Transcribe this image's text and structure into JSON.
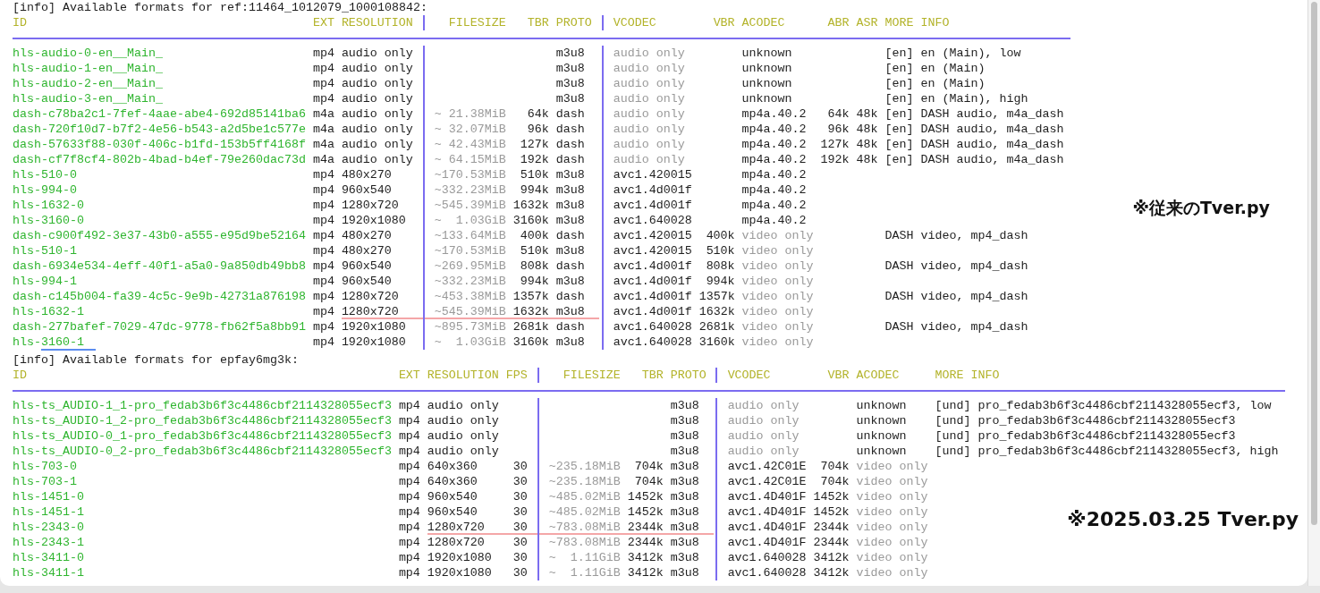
{
  "tables": [
    {
      "info": "[info] Available formats for ref:11464_1012079_1000108842:",
      "columns": [
        "ID",
        "EXT",
        "RESOLUTION",
        "FILESIZE",
        "TBR",
        "PROTO",
        "VCODEC",
        "VBR",
        "ACODEC",
        "ABR",
        "ASR",
        "MORE INFO"
      ],
      "rows": [
        {
          "kind": "audio",
          "highlighted": false,
          "id_underlined": false,
          "id": "hls-audio-0-en__Main_",
          "ext": "mp4",
          "resolution": "audio only",
          "proto": "m3u8",
          "vcodec": "audio only",
          "acodec": "unknown",
          "more_info": "[en] en (Main), low"
        },
        {
          "kind": "audio",
          "highlighted": false,
          "id_underlined": false,
          "id": "hls-audio-1-en__Main_",
          "ext": "mp4",
          "resolution": "audio only",
          "proto": "m3u8",
          "vcodec": "audio only",
          "acodec": "unknown",
          "more_info": "[en] en (Main)"
        },
        {
          "kind": "audio",
          "highlighted": false,
          "id_underlined": false,
          "id": "hls-audio-2-en__Main_",
          "ext": "mp4",
          "resolution": "audio only",
          "proto": "m3u8",
          "vcodec": "audio only",
          "acodec": "unknown",
          "more_info": "[en] en (Main)"
        },
        {
          "kind": "audio",
          "highlighted": false,
          "id_underlined": false,
          "id": "hls-audio-3-en__Main_",
          "ext": "mp4",
          "resolution": "audio only",
          "proto": "m3u8",
          "vcodec": "audio only",
          "acodec": "unknown",
          "more_info": "[en] en (Main), high"
        },
        {
          "kind": "audio",
          "highlighted": false,
          "id_underlined": false,
          "id": "dash-c78ba2c1-7fef-4aae-abe4-692d85141ba6",
          "ext": "m4a",
          "resolution": "audio only",
          "filesize": "~ 21.38MiB",
          "tbr": "64k",
          "proto": "dash",
          "vcodec": "audio only",
          "acodec": "mp4a.40.2",
          "abr": "64k",
          "asr": "48k",
          "more_info": "[en] DASH audio, m4a_dash"
        },
        {
          "kind": "audio",
          "highlighted": false,
          "id_underlined": false,
          "id": "dash-720f10d7-b7f2-4e56-b543-a2d5be1c577e",
          "ext": "m4a",
          "resolution": "audio only",
          "filesize": "~ 32.07MiB",
          "tbr": "96k",
          "proto": "dash",
          "vcodec": "audio only",
          "acodec": "mp4a.40.2",
          "abr": "96k",
          "asr": "48k",
          "more_info": "[en] DASH audio, m4a_dash"
        },
        {
          "kind": "audio",
          "highlighted": false,
          "id_underlined": false,
          "id": "dash-57633f88-030f-406c-b1fd-153b5ff4168f",
          "ext": "m4a",
          "resolution": "audio only",
          "filesize": "~ 42.43MiB",
          "tbr": "127k",
          "proto": "dash",
          "vcodec": "audio only",
          "acodec": "mp4a.40.2",
          "abr": "127k",
          "asr": "48k",
          "more_info": "[en] DASH audio, m4a_dash"
        },
        {
          "kind": "audio",
          "highlighted": false,
          "id_underlined": false,
          "id": "dash-cf7f8cf4-802b-4bad-b4ef-79e260dac73d",
          "ext": "m4a",
          "resolution": "audio only",
          "filesize": "~ 64.15MiB",
          "tbr": "192k",
          "proto": "dash",
          "vcodec": "audio only",
          "acodec": "mp4a.40.2",
          "abr": "192k",
          "asr": "48k",
          "more_info": "[en] DASH audio, m4a_dash"
        },
        {
          "kind": "muxed",
          "highlighted": false,
          "id_underlined": false,
          "id": "hls-510-0",
          "ext": "mp4",
          "resolution": "480x270",
          "filesize": "~170.53MiB",
          "tbr": "510k",
          "proto": "m3u8",
          "vcodec": "avc1.420015",
          "acodec": "mp4a.40.2"
        },
        {
          "kind": "muxed",
          "highlighted": false,
          "id_underlined": false,
          "id": "hls-994-0",
          "ext": "mp4",
          "resolution": "960x540",
          "filesize": "~332.23MiB",
          "tbr": "994k",
          "proto": "m3u8",
          "vcodec": "avc1.4d001f",
          "acodec": "mp4a.40.2"
        },
        {
          "kind": "muxed",
          "highlighted": false,
          "id_underlined": false,
          "id": "hls-1632-0",
          "ext": "mp4",
          "resolution": "1280x720",
          "filesize": "~545.39MiB",
          "tbr": "1632k",
          "proto": "m3u8",
          "vcodec": "avc1.4d001f",
          "acodec": "mp4a.40.2"
        },
        {
          "kind": "muxed",
          "highlighted": false,
          "id_underlined": false,
          "id": "hls-3160-0",
          "ext": "mp4",
          "resolution": "1920x1080",
          "filesize": "~  1.03GiB",
          "tbr": "3160k",
          "proto": "m3u8",
          "vcodec": "avc1.640028",
          "acodec": "mp4a.40.2"
        },
        {
          "kind": "video",
          "highlighted": false,
          "id_underlined": false,
          "id": "dash-c900f492-3e37-43b0-a555-e95d9be52164",
          "ext": "mp4",
          "resolution": "480x270",
          "filesize": "~133.64MiB",
          "tbr": "400k",
          "proto": "dash",
          "vcodec": "avc1.420015",
          "vbr": "400k",
          "acodec": "video only",
          "more_info": "DASH video, mp4_dash"
        },
        {
          "kind": "video",
          "highlighted": false,
          "id_underlined": false,
          "id": "hls-510-1",
          "ext": "mp4",
          "resolution": "480x270",
          "filesize": "~170.53MiB",
          "tbr": "510k",
          "proto": "m3u8",
          "vcodec": "avc1.420015",
          "vbr": "510k",
          "acodec": "video only"
        },
        {
          "kind": "video",
          "highlighted": false,
          "id_underlined": false,
          "id": "dash-6934e534-4eff-40f1-a5a0-9a850db49bb8",
          "ext": "mp4",
          "resolution": "960x540",
          "filesize": "~269.95MiB",
          "tbr": "808k",
          "proto": "dash",
          "vcodec": "avc1.4d001f",
          "vbr": "808k",
          "acodec": "video only",
          "more_info": "DASH video, mp4_dash"
        },
        {
          "kind": "video",
          "highlighted": false,
          "id_underlined": false,
          "id": "hls-994-1",
          "ext": "mp4",
          "resolution": "960x540",
          "filesize": "~332.23MiB",
          "tbr": "994k",
          "proto": "m3u8",
          "vcodec": "avc1.4d001f",
          "vbr": "994k",
          "acodec": "video only"
        },
        {
          "kind": "video",
          "highlighted": false,
          "id_underlined": false,
          "id": "dash-c145b004-fa39-4c5c-9e9b-42731a876198",
          "ext": "mp4",
          "resolution": "1280x720",
          "filesize": "~453.38MiB",
          "tbr": "1357k",
          "proto": "dash",
          "vcodec": "avc1.4d001f",
          "vbr": "1357k",
          "acodec": "video only",
          "more_info": "DASH video, mp4_dash"
        },
        {
          "kind": "video",
          "highlighted": true,
          "id_underlined": false,
          "id": "hls-1632-1",
          "ext": "mp4",
          "resolution": "1280x720",
          "filesize": "~545.39MiB",
          "tbr": "1632k",
          "proto": "m3u8",
          "vcodec": "avc1.4d001f",
          "vbr": "1632k",
          "acodec": "video only"
        },
        {
          "kind": "video",
          "highlighted": false,
          "id_underlined": false,
          "id": "dash-277bafef-7029-47dc-9778-fb62f5a8bb91",
          "ext": "mp4",
          "resolution": "1920x1080",
          "filesize": "~895.73MiB",
          "tbr": "2681k",
          "proto": "dash",
          "vcodec": "avc1.640028",
          "vbr": "2681k",
          "acodec": "video only",
          "more_info": "DASH video, mp4_dash"
        },
        {
          "kind": "video",
          "highlighted": false,
          "id_underlined": true,
          "id": "hls-3160-1",
          "ext": "mp4",
          "resolution": "1920x1080",
          "filesize": "~  1.03GiB",
          "tbr": "3160k",
          "proto": "m3u8",
          "vcodec": "avc1.640028",
          "vbr": "3160k",
          "acodec": "video only"
        }
      ]
    },
    {
      "info": "[info] Available formats for epfay6mg3k:",
      "columns": [
        "ID",
        "EXT",
        "RESOLUTION",
        "FPS",
        "FILESIZE",
        "TBR",
        "PROTO",
        "VCODEC",
        "VBR",
        "ACODEC",
        "MORE INFO"
      ],
      "rows": [
        {
          "kind": "audio",
          "highlighted": false,
          "id_underlined": false,
          "id": "hls-ts_AUDIO-1_1-pro_fedab3b6f3c4486cbf2114328055ecf3",
          "ext": "mp4",
          "resolution": "audio only",
          "proto": "m3u8",
          "vcodec": "audio only",
          "acodec": "unknown",
          "more_info": "[und] pro_fedab3b6f3c4486cbf2114328055ecf3, low"
        },
        {
          "kind": "audio",
          "highlighted": false,
          "id_underlined": false,
          "id": "hls-ts_AUDIO-1_2-pro_fedab3b6f3c4486cbf2114328055ecf3",
          "ext": "mp4",
          "resolution": "audio only",
          "proto": "m3u8",
          "vcodec": "audio only",
          "acodec": "unknown",
          "more_info": "[und] pro_fedab3b6f3c4486cbf2114328055ecf3"
        },
        {
          "kind": "audio",
          "highlighted": false,
          "id_underlined": false,
          "id": "hls-ts_AUDIO-0_1-pro_fedab3b6f3c4486cbf2114328055ecf3",
          "ext": "mp4",
          "resolution": "audio only",
          "proto": "m3u8",
          "vcodec": "audio only",
          "acodec": "unknown",
          "more_info": "[und] pro_fedab3b6f3c4486cbf2114328055ecf3"
        },
        {
          "kind": "audio",
          "highlighted": false,
          "id_underlined": false,
          "id": "hls-ts_AUDIO-0_2-pro_fedab3b6f3c4486cbf2114328055ecf3",
          "ext": "mp4",
          "resolution": "audio only",
          "proto": "m3u8",
          "vcodec": "audio only",
          "acodec": "unknown",
          "more_info": "[und] pro_fedab3b6f3c4486cbf2114328055ecf3, high"
        },
        {
          "kind": "video",
          "highlighted": false,
          "id_underlined": false,
          "id": "hls-703-0",
          "ext": "mp4",
          "resolution": "640x360",
          "fps": "30",
          "filesize": "~235.18MiB",
          "tbr": "704k",
          "proto": "m3u8",
          "vcodec": "avc1.42C01E",
          "vbr": "704k",
          "acodec": "video only"
        },
        {
          "kind": "video",
          "highlighted": false,
          "id_underlined": false,
          "id": "hls-703-1",
          "ext": "mp4",
          "resolution": "640x360",
          "fps": "30",
          "filesize": "~235.18MiB",
          "tbr": "704k",
          "proto": "m3u8",
          "vcodec": "avc1.42C01E",
          "vbr": "704k",
          "acodec": "video only"
        },
        {
          "kind": "video",
          "highlighted": false,
          "id_underlined": false,
          "id": "hls-1451-0",
          "ext": "mp4",
          "resolution": "960x540",
          "fps": "30",
          "filesize": "~485.02MiB",
          "tbr": "1452k",
          "proto": "m3u8",
          "vcodec": "avc1.4D401F",
          "vbr": "1452k",
          "acodec": "video only"
        },
        {
          "kind": "video",
          "highlighted": false,
          "id_underlined": false,
          "id": "hls-1451-1",
          "ext": "mp4",
          "resolution": "960x540",
          "fps": "30",
          "filesize": "~485.02MiB",
          "tbr": "1452k",
          "proto": "m3u8",
          "vcodec": "avc1.4D401F",
          "vbr": "1452k",
          "acodec": "video only"
        },
        {
          "kind": "video",
          "highlighted": true,
          "id_underlined": false,
          "id": "hls-2343-0",
          "ext": "mp4",
          "resolution": "1280x720",
          "fps": "30",
          "filesize": "~783.08MiB",
          "tbr": "2344k",
          "proto": "m3u8",
          "vcodec": "avc1.4D401F",
          "vbr": "2344k",
          "acodec": "video only"
        },
        {
          "kind": "video",
          "highlighted": false,
          "id_underlined": false,
          "id": "hls-2343-1",
          "ext": "mp4",
          "resolution": "1280x720",
          "fps": "30",
          "filesize": "~783.08MiB",
          "tbr": "2344k",
          "proto": "m3u8",
          "vcodec": "avc1.4D401F",
          "vbr": "2344k",
          "acodec": "video only"
        },
        {
          "kind": "video",
          "highlighted": false,
          "id_underlined": false,
          "id": "hls-3411-0",
          "ext": "mp4",
          "resolution": "1920x1080",
          "fps": "30",
          "filesize": "~  1.11GiB",
          "tbr": "3412k",
          "proto": "m3u8",
          "vcodec": "avc1.640028",
          "vbr": "3412k",
          "acodec": "video only"
        },
        {
          "kind": "video",
          "highlighted": false,
          "id_underlined": false,
          "id": "hls-3411-1",
          "ext": "mp4",
          "resolution": "1920x1080",
          "fps": "30",
          "filesize": "~  1.11GiB",
          "tbr": "3412k",
          "proto": "m3u8",
          "vcodec": "avc1.640028",
          "vbr": "3412k",
          "acodec": "video only"
        }
      ]
    }
  ],
  "annotations": [
    "※従来のTver.py",
    "※2025.03.25 Tver.py"
  ]
}
